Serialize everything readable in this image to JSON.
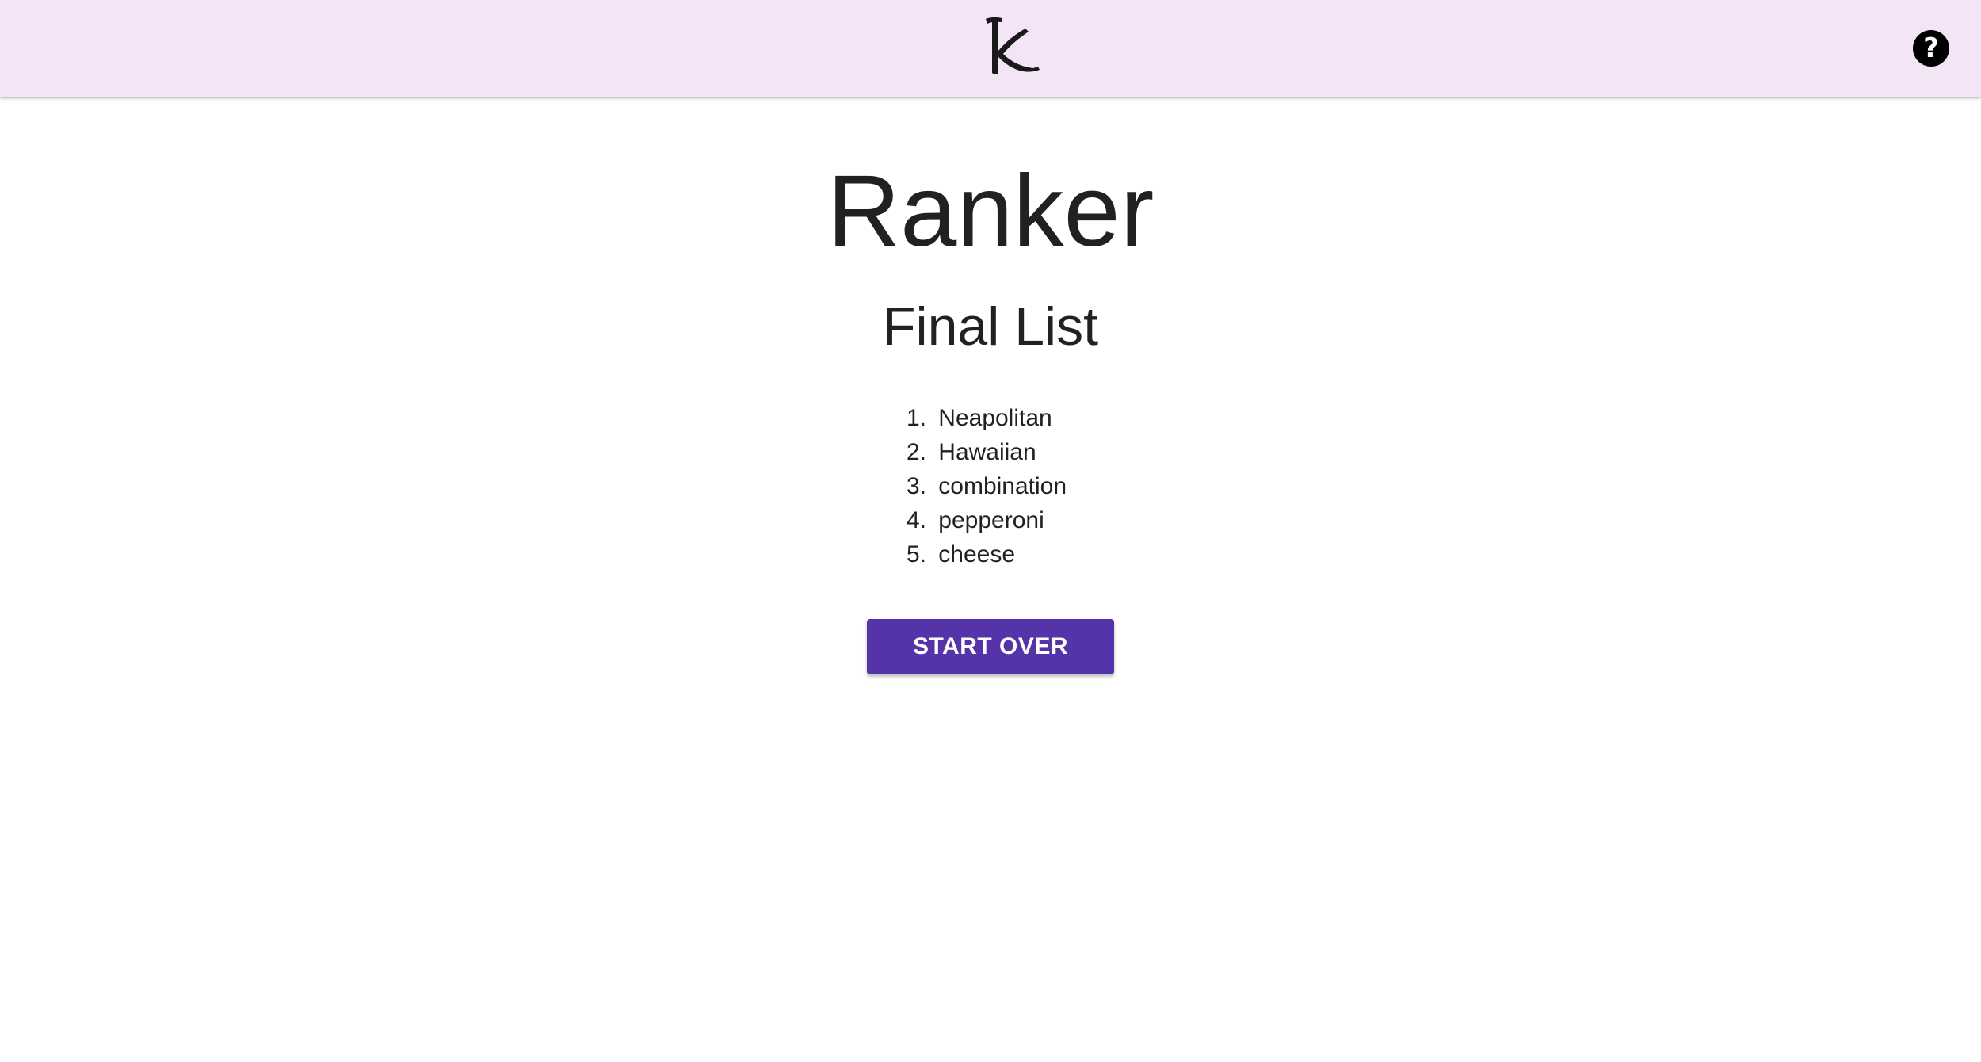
{
  "header": {
    "logo_icon": "k-logo-icon",
    "help_icon": "help-icon",
    "help_label": "?",
    "background_color": "#f3e5f5"
  },
  "main": {
    "title": "Ranker",
    "subtitle": "Final List",
    "list": [
      {
        "number": "1.",
        "label": "Neapolitan"
      },
      {
        "number": "2.",
        "label": "Hawaiian"
      },
      {
        "number": "3.",
        "label": "combination"
      },
      {
        "number": "4.",
        "label": "pepperoni"
      },
      {
        "number": "5.",
        "label": "cheese"
      }
    ],
    "start_over_label": "START OVER",
    "accent_color": "#5533a8"
  }
}
